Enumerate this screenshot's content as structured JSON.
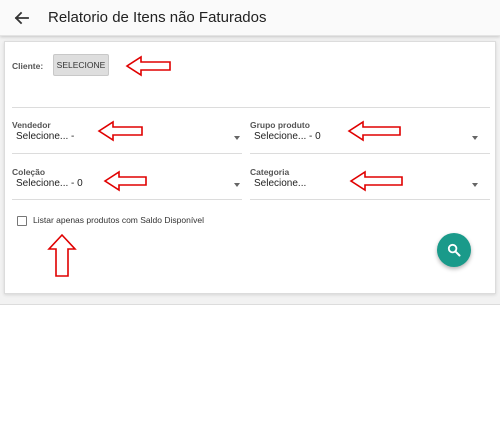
{
  "appbar": {
    "title": "Relatorio de Itens não Faturados",
    "back_icon": "arrow-left-icon"
  },
  "filters": {
    "cliente": {
      "label": "Cliente:",
      "button": "SELECIONE"
    },
    "vendedor": {
      "label": "Vendedor",
      "value": "Selecione... -"
    },
    "grupo_produto": {
      "label": "Grupo produto",
      "value": "Selecione... - 0"
    },
    "colecao": {
      "label": "Coleção",
      "value": "Selecione... - 0"
    },
    "categoria": {
      "label": "Categoria",
      "value": "Selecione..."
    },
    "saldo_checkbox": {
      "label": "Listar apenas produtos com Saldo Disponível",
      "checked": false
    }
  },
  "search_button": {
    "icon": "search-icon",
    "color": "#1a9a8a"
  },
  "annotation": {
    "arrow_color": "#e00000"
  }
}
